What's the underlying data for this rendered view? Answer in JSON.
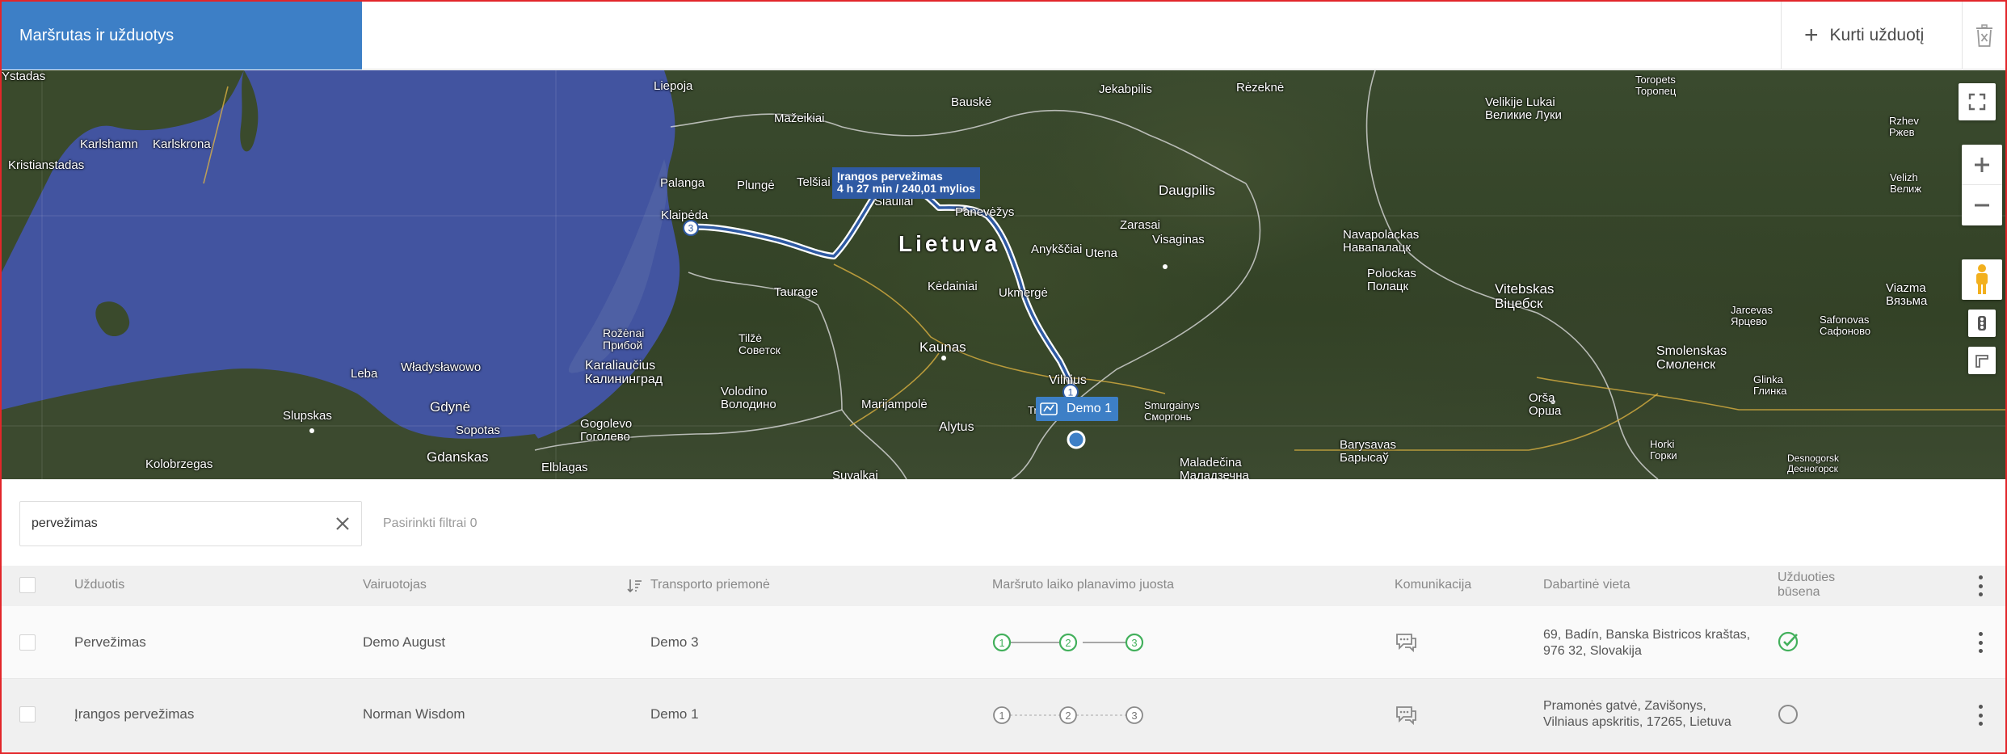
{
  "header": {
    "title": "Maršrutas ir užduotys",
    "create_label": "Kurti užduotį",
    "create_icon": "plus-icon",
    "delete_icon": "trash-icon"
  },
  "map": {
    "route_tooltip": {
      "line1": "Įrangos pervežimas",
      "line2": "4 h 27 min / 240,01 mylios"
    },
    "vehicle_label": "Demo 1",
    "stop_badges": [
      "1",
      "3"
    ],
    "labels": {
      "lietuva": "Lietuva",
      "liepoja": "Liepoja",
      "bauske": "Bauskė",
      "jekabpilis": "Jekabpilis",
      "rezekne": "Rėzeknė",
      "toropets": "Toropets\nТоропец",
      "mazeikiai": "Mažeikiai",
      "velikije_lukai": "Velikije Lukai\nВеликие Луки",
      "karlshamn": "Karlshamn",
      "karlskrona": "Karlskrona",
      "rzhev": "Rzhev\nРжев",
      "kristianstad": "Kristianstadas",
      "palanga": "Palanga",
      "plunge": "Plungė",
      "telsiai": "Telšiai",
      "siauliai": "Šiauliai",
      "panevezys": "Panevėžys",
      "daugpilis": "Daugpilis",
      "velizh": "Velizh\nВелиж",
      "klaipeda": "Klaipėda",
      "anyksciai": "Anykščiai",
      "zarasai": "Zarasai",
      "visaginas": "Visaginas",
      "utena": "Utena",
      "navapolackas": "Navapolackas\nНавапалацк",
      "polockas": "Polockas\nПолацк",
      "ystad": "Ystadas",
      "taurage": "Taurage",
      "kedainiai": "Kėdainiai",
      "ukmerge": "Ukmergė",
      "vitebskas": "Vitebskas\nВіцебск",
      "viazma": "Viazma\nВязьма",
      "jarcevas": "Jarcevas\nЯрцево",
      "safonovas": "Safonovas\nСафоново",
      "rozenai": "Rožėnai\nПрибой",
      "tilze": "Tilžė\nСоветск",
      "kaunas": "Kaunas",
      "smolenskas": "Smolenskas\nСмоленск",
      "leba": "Leba",
      "wladyslawowo": "Władysławowo",
      "karaliaucius": "Karaliaučius\nКалининград",
      "vilnius": "Vilnius",
      "glinka": "Glinka\nГлинка",
      "volodino": "Volodino\nВолодино",
      "marijampole": "Marijampolė",
      "trakai": "Trakai",
      "smurgainys": "Smurgainys\nСморгонь",
      "orsa": "Orša\nОрша",
      "slupskas": "Slupskas",
      "gdyne": "Gdynė",
      "gogolevo": "Gogolevo\nГоголево",
      "alytus": "Alytus",
      "sopotas": "Sopotas",
      "gdanskas": "Gdanskas",
      "elblagas": "Elblagas",
      "kolobrzegas": "Kolobrzegas",
      "suvalkai": "Suvalkai",
      "maladecina": "Maladečina\nМаладзечна",
      "barysavas": "Barysavas\nБарысаў",
      "horki": "Horki\nГорки",
      "desnogorsk": "Desnogorsk\nДесногорск"
    }
  },
  "filters": {
    "search_value": "pervežimas",
    "selected_filters": "Pasirinkti filtrai 0"
  },
  "table": {
    "columns": {
      "task": "Užduotis",
      "driver": "Vairuotojas",
      "vehicle": "Transporto priemonė",
      "timeline": "Maršruto laiko planavimo juosta",
      "communication": "Komunikacija",
      "location": "Dabartinė vieta",
      "status_line1": "Užduoties",
      "status_line2": "būsena"
    },
    "rows": [
      {
        "task": "Pervežimas",
        "driver": "Demo August",
        "vehicle": "Demo 3",
        "stops": [
          "1",
          "2",
          "3"
        ],
        "timeline_state": "completed",
        "location_line1": "69, Badín, Banska Bistricos kraštas,",
        "location_line2": "976 32, Slovakija",
        "status": "completed"
      },
      {
        "task": "Įrangos pervežimas",
        "driver": "Norman Wisdom",
        "vehicle": "Demo 1",
        "stops": [
          "1",
          "2",
          "3"
        ],
        "timeline_state": "pending",
        "location_line1": "Pramonės gatvė, Zavišonys,",
        "location_line2": "Vilniaus apskritis, 17265, Lietuva",
        "status": "pending"
      }
    ]
  },
  "colors": {
    "header_blue": "#3d7fc6",
    "frame_red": "#e2262a",
    "done_green": "#43b05c",
    "sea_blue": "#4254a0",
    "route_blue": "#2f5aa3",
    "pending_gray": "#8a8a8a"
  }
}
